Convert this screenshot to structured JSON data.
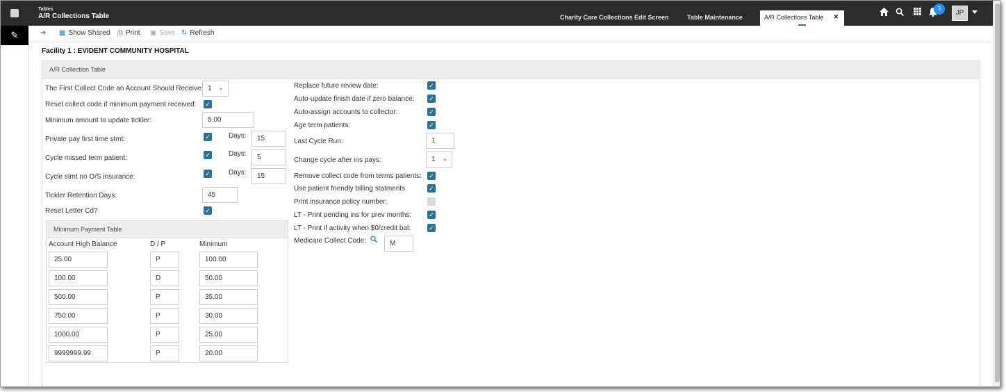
{
  "header": {
    "section": "Tables",
    "title": "A/R Collections Table",
    "tabs": [
      {
        "label": "Charity Care Collections Edit Screen"
      },
      {
        "label": "Table Maintenance"
      },
      {
        "label": "A/R Collections Table",
        "close": "✕"
      }
    ],
    "notification_count": "3",
    "user_initials": "JP",
    "icons": {
      "home": "home-icon",
      "search": "search-icon",
      "apps": "grid-icon",
      "bell": "bell-icon"
    }
  },
  "toolbar": {
    "show_shared": "Show Shared",
    "print": "Print",
    "save": "Save",
    "refresh": "Refresh"
  },
  "facility": "Facility 1 : EVIDENT COMMUNITY HOSPITAL",
  "panel_title": "A/R Collection Table",
  "left_form": {
    "first_collect_code": {
      "label": "The First Collect Code an Account Should Receive:",
      "value": "1"
    },
    "reset_collect_code": {
      "label": "Reset collect code if minimum payment received:"
    },
    "minimum_amount": {
      "label": "Minimum amount to update tickler:",
      "value": "5.00"
    },
    "private_pay": {
      "label": "Private pay first time stmt:",
      "days_label": "Days:",
      "days": "15"
    },
    "cycle_missed": {
      "label": "Cycle missed term patient:",
      "days_label": "Days:",
      "days": "5"
    },
    "cycle_stmt": {
      "label": "Cycle stmt no O/S insurance:",
      "days_label": "Days:",
      "days": "15"
    },
    "tickler_retention": {
      "label": "Tickler Retention Days:",
      "value": "45"
    },
    "reset_letter": {
      "label": "Reset Letter Cd?"
    }
  },
  "right_form": {
    "replace_review": {
      "label": "Replace future review date:",
      "checked": true
    },
    "auto_update_finish": {
      "label": "Auto-update finish date if zero balance:",
      "checked": true
    },
    "auto_assign": {
      "label": "Auto-assign accounts to collector:",
      "checked": true
    },
    "age_term": {
      "label": "Age term patients:",
      "checked": true
    },
    "last_cycle_run": {
      "label": "Last Cycle Run:",
      "value": "1"
    },
    "change_cycle": {
      "label": "Change cycle after ins pays:",
      "value": "1"
    },
    "remove_collect": {
      "label": "Remove collect code from terms patients:",
      "checked": true
    },
    "patient_friendly": {
      "label": "Use patient friendly billing statments",
      "checked": true
    },
    "print_insurance": {
      "label": "Print insurance policy number:",
      "checked": false
    },
    "lt_pending": {
      "label": "LT - Print pending ins for prev months:",
      "checked": true
    },
    "lt_activity": {
      "label": "LT - Print if activity when $0/credit bal:",
      "checked": true
    },
    "medicare_code": {
      "label": "Medicare Collect Code:",
      "value": "M"
    }
  },
  "min_payment_table": {
    "title": "Minimum Payment Table",
    "columns": [
      "Account High Balance",
      "D / P",
      "Minimum"
    ],
    "rows": [
      [
        "25.00",
        "P",
        "100.00"
      ],
      [
        "100.00",
        "D",
        "50.00"
      ],
      [
        "500.00",
        "P",
        "35.00"
      ],
      [
        "750.00",
        "P",
        "30.00"
      ],
      [
        "1000.00",
        "P",
        "25.00"
      ],
      [
        "9999999.99",
        "P",
        "20.00"
      ]
    ]
  },
  "colors": {
    "topbar": "#2c2c2c",
    "checkbox": "#2e6f93",
    "accent": "#2f78c5",
    "badge": "#1e90ff"
  }
}
